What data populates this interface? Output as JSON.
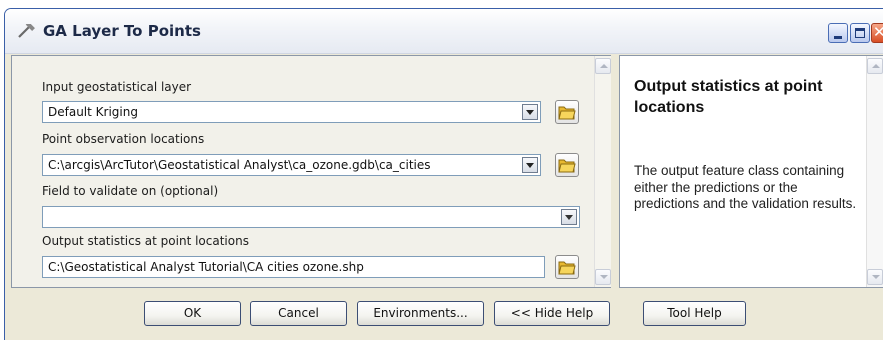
{
  "window": {
    "title": "GA Layer To Points"
  },
  "form": {
    "input_layer": {
      "label": "Input geostatistical layer",
      "value": "Default Kriging"
    },
    "point_locations": {
      "label": "Point observation locations",
      "value": "C:\\arcgis\\ArcTutor\\Geostatistical Analyst\\ca_ozone.gdb\\ca_cities"
    },
    "validate_field": {
      "label": "Field to validate on (optional)",
      "value": ""
    },
    "output_stats": {
      "label": "Output statistics at point locations",
      "value": "C:\\Geostatistical Analyst Tutorial\\CA cities ozone.shp"
    }
  },
  "help": {
    "title": "Output statistics at point locations",
    "body": "The output feature class containing either the predictions or the predictions and the validation results."
  },
  "buttons": {
    "ok": "OK",
    "cancel": "Cancel",
    "environments": "Environments...",
    "hide_help": "<< Hide Help",
    "tool_help": "Tool Help"
  },
  "icons": {
    "app": "hammer-icon",
    "browse": "folder-open-icon",
    "dropdown": "chevron-down-icon",
    "minimize": "minimize-icon",
    "maximize": "maximize-icon",
    "close": "close-icon"
  },
  "colors": {
    "close_button": "#d84e25",
    "folder": "#f0c040"
  }
}
